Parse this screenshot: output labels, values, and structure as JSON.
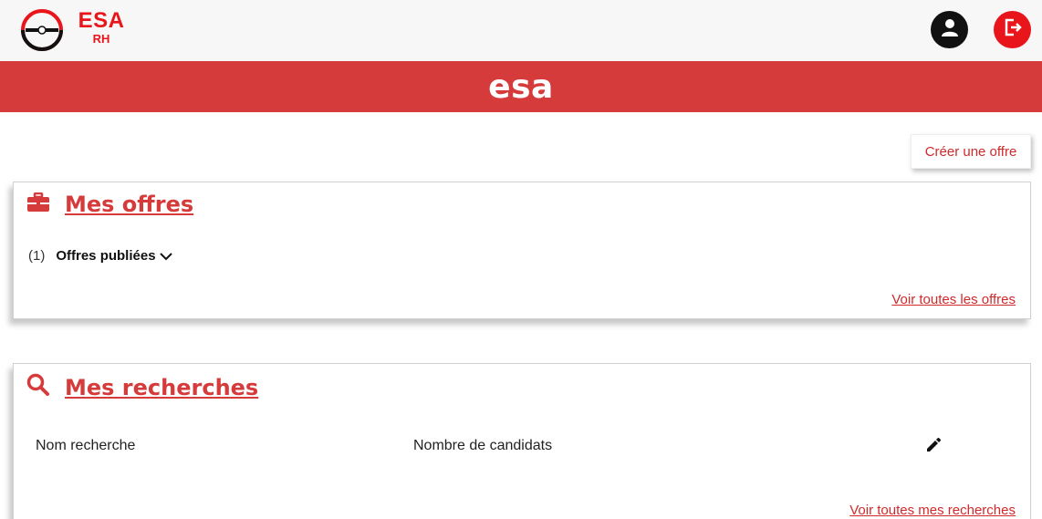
{
  "header": {
    "brand": "ESA",
    "brand_sub": "RH",
    "icons": {
      "logo": "esa-logo-icon",
      "user": "user-icon",
      "logout": "logout-icon"
    }
  },
  "banner": {
    "title": "esa"
  },
  "actions": {
    "create_offer": "Créer une offre"
  },
  "offres": {
    "icon": "briefcase-icon",
    "title": "Mes offres",
    "count": "(1)",
    "group_label": "Offres publiées",
    "see_all": "Voir toutes les offres"
  },
  "recherches": {
    "icon": "search-icon",
    "title": "Mes recherches",
    "columns": [
      "Nom recherche",
      "Nombre de candidats"
    ],
    "see_all": "Voir toutes mes recherches"
  },
  "colors": {
    "brand_red": "#e8151b",
    "banner_red": "#d63b3c",
    "link_red": "#d2292b"
  }
}
